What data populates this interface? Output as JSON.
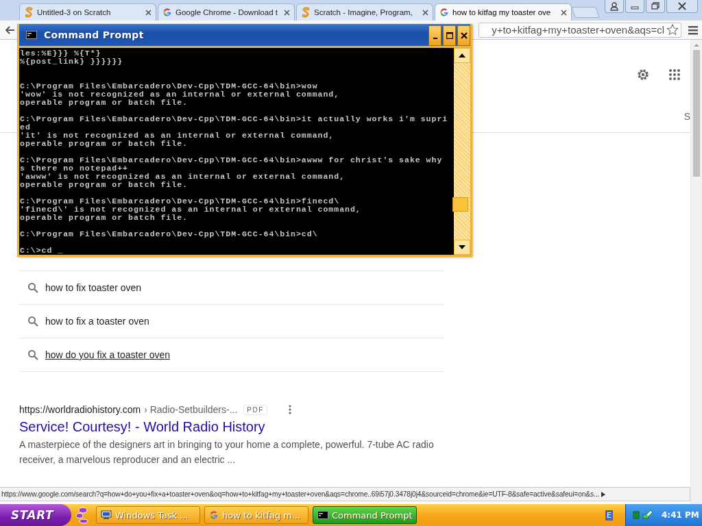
{
  "browser": {
    "tabs": [
      {
        "title": "Untitled-3 on Scratch",
        "kind": "scratch",
        "selected": false
      },
      {
        "title": "Google Chrome - Download t",
        "kind": "google",
        "selected": false
      },
      {
        "title": "Scratch - Imagine, Program,",
        "kind": "scratch",
        "selected": false
      },
      {
        "title": "how to kitfag my toaster ove",
        "kind": "google",
        "selected": true
      }
    ],
    "address": "y+to+kitfag+my+toaster+oven&aqs=cl"
  },
  "page": {
    "cut_tab_letter": "S",
    "related_searches": [
      {
        "text": "how to fix toaster oven",
        "hovered": false
      },
      {
        "text": "how to fix a toaster oven",
        "hovered": false
      },
      {
        "text": "how do you fix a toaster oven",
        "hovered": true
      }
    ],
    "result": {
      "url": "https://worldradiohistory.com",
      "breadcrumb": "› Radio-Setbuilders-...",
      "badge": "PDF",
      "title": "Service! Courtesy! - World Radio History",
      "snippet": "A masterpiece of the designers art in bringing to your home a complete, powerful. 7-tube AC radio receiver, a marvelous reproducer and an electric ..."
    }
  },
  "status_url": "https://www.google.com/search?q=how+do+you+fix+a+toaster+oven&oq=how+to+kitfag+my+toaster+oven&aqs=chrome..69i57j0.3478j0j4&sourceid=chrome&ie=UTF-8&safe=active&safeui=on&s...",
  "cmd_window": {
    "title": "Command Prompt",
    "blocks": [
      {
        "lines": [
          "les:%E}}} %{T*}",
          "%{post_link} }}}}}}"
        ]
      },
      {
        "lines": [
          "C:\\Program Files\\Embarcadero\\Dev-Cpp\\TDM-GCC-64\\bin>wow",
          "'wow' is not recognized as an internal or external command,",
          "operable program or batch file."
        ]
      },
      {
        "lines": [
          "C:\\Program Files\\Embarcadero\\Dev-Cpp\\TDM-GCC-64\\bin>it actually works i'm supri",
          "ed",
          "'it' is not recognized as an internal or external command,",
          "operable program or batch file."
        ]
      },
      {
        "lines": [
          "C:\\Program Files\\Embarcadero\\Dev-Cpp\\TDM-GCC-64\\bin>awww for christ's sake why",
          "s there no notepad++",
          "'awww' is not recognized as an internal or external command,",
          "operable program or batch file."
        ]
      },
      {
        "lines": [
          "C:\\Program Files\\Embarcadero\\Dev-Cpp\\TDM-GCC-64\\bin>finecd\\",
          "'finecd\\' is not recognized as an internal or external command,",
          "operable program or batch file."
        ]
      },
      {
        "lines": [
          "C:\\Program Files\\Embarcadero\\Dev-Cpp\\TDM-GCC-64\\bin>cd\\"
        ]
      },
      {
        "lines": [
          "C:\\>cd _"
        ]
      }
    ]
  },
  "taskbar": {
    "start": "START",
    "tasks": [
      {
        "label": "Windows Task ...",
        "kind": "monitor",
        "selected": false
      },
      {
        "label": "how to kitfag m...",
        "kind": "google",
        "selected": false
      },
      {
        "label": "Command Prompt",
        "kind": "console",
        "selected": true
      }
    ],
    "language": "E",
    "clock": "4:41 PM"
  }
}
